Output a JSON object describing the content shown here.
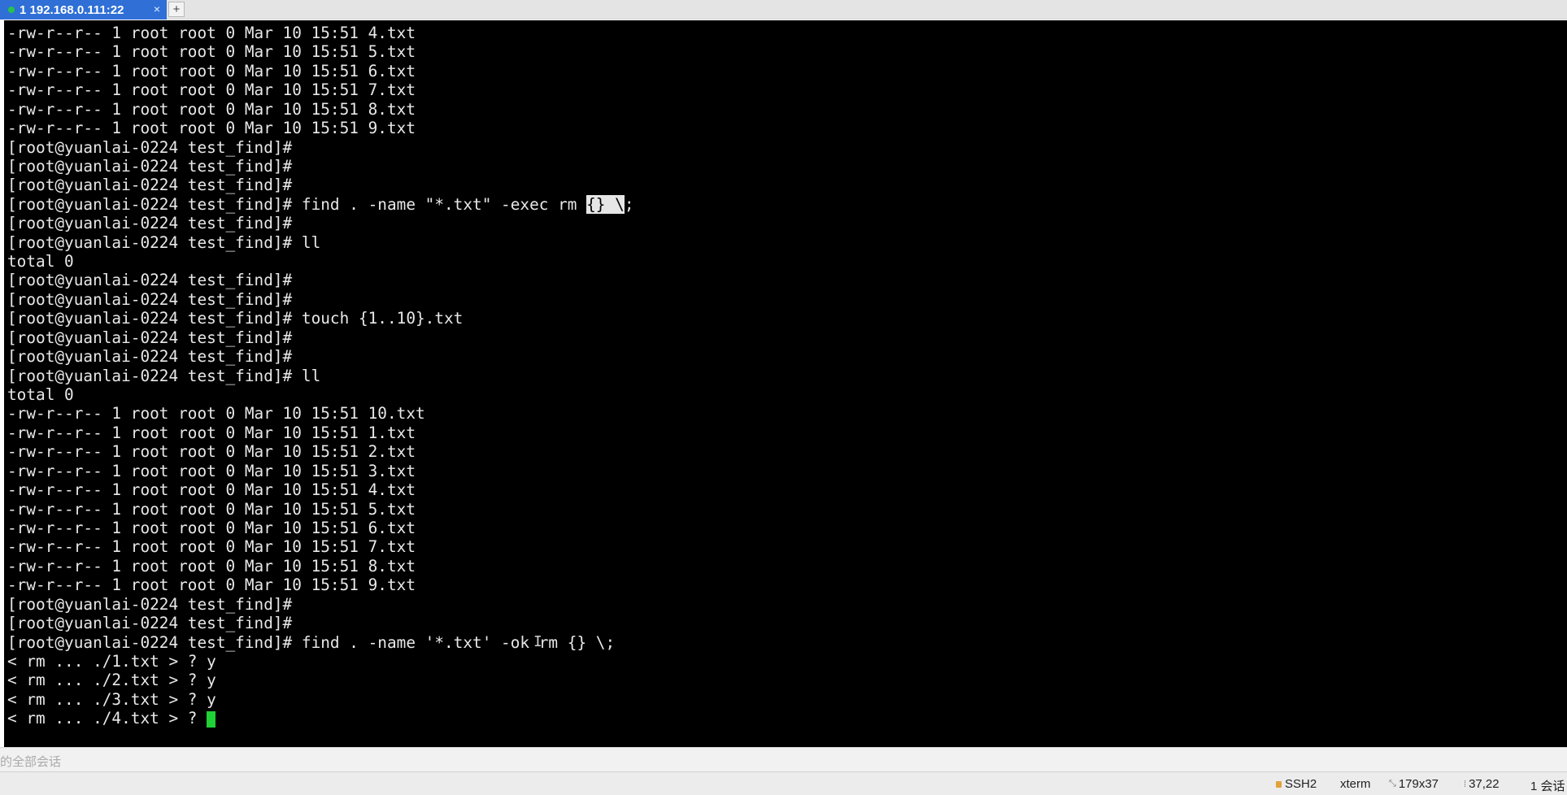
{
  "tab": {
    "title": "1 192.168.0.111:22",
    "close_glyph": "×",
    "add_glyph": "+",
    "status_color": "#27c24c",
    "color": "#2f6fd6"
  },
  "terminal": {
    "lines": [
      "-rw-r--r-- 1 root root 0 Mar 10 15:51 4.txt",
      "-rw-r--r-- 1 root root 0 Mar 10 15:51 5.txt",
      "-rw-r--r-- 1 root root 0 Mar 10 15:51 6.txt",
      "-rw-r--r-- 1 root root 0 Mar 10 15:51 7.txt",
      "-rw-r--r-- 1 root root 0 Mar 10 15:51 8.txt",
      "-rw-r--r-- 1 root root 0 Mar 10 15:51 9.txt",
      "[root@yuanlai-0224 test_find]#",
      "[root@yuanlai-0224 test_find]#",
      "[root@yuanlai-0224 test_find]#",
      null,
      "[root@yuanlai-0224 test_find]#",
      "[root@yuanlai-0224 test_find]# ll",
      "total 0",
      "[root@yuanlai-0224 test_find]#",
      "[root@yuanlai-0224 test_find]#",
      "[root@yuanlai-0224 test_find]# touch {1..10}.txt",
      "[root@yuanlai-0224 test_find]#",
      "[root@yuanlai-0224 test_find]#",
      "[root@yuanlai-0224 test_find]# ll",
      "total 0",
      "-rw-r--r-- 1 root root 0 Mar 10 15:51 10.txt",
      "-rw-r--r-- 1 root root 0 Mar 10 15:51 1.txt",
      "-rw-r--r-- 1 root root 0 Mar 10 15:51 2.txt",
      "-rw-r--r-- 1 root root 0 Mar 10 15:51 3.txt",
      "-rw-r--r-- 1 root root 0 Mar 10 15:51 4.txt",
      "-rw-r--r-- 1 root root 0 Mar 10 15:51 5.txt",
      "-rw-r--r-- 1 root root 0 Mar 10 15:51 6.txt",
      "-rw-r--r-- 1 root root 0 Mar 10 15:51 7.txt",
      "-rw-r--r-- 1 root root 0 Mar 10 15:51 8.txt",
      "-rw-r--r-- 1 root root 0 Mar 10 15:51 9.txt",
      "[root@yuanlai-0224 test_find]#",
      "[root@yuanlai-0224 test_find]#",
      "[root@yuanlai-0224 test_find]# find . -name '*.txt' -ok rm {} \\;",
      "< rm ... ./1.txt > ? y",
      "< rm ... ./2.txt > ? y",
      "< rm ... ./3.txt > ? y",
      null
    ],
    "highlight_line": {
      "before": "[root@yuanlai-0224 test_find]# find . -name \"*.txt\" -exec rm ",
      "selected": "{} \\",
      "after": ";"
    },
    "current_line": {
      "text": "< rm ... ./4.txt > ? ",
      "cursor_color": "#21d037"
    },
    "background": "#000000",
    "foreground": "#e8e8e8"
  },
  "session_bar": {
    "label": "的全部会话"
  },
  "statusbar": {
    "protocol": "SSH2",
    "term_type": "xterm",
    "size": "179x37",
    "cursor_pos": "37,22",
    "sessions": "1 会话"
  }
}
